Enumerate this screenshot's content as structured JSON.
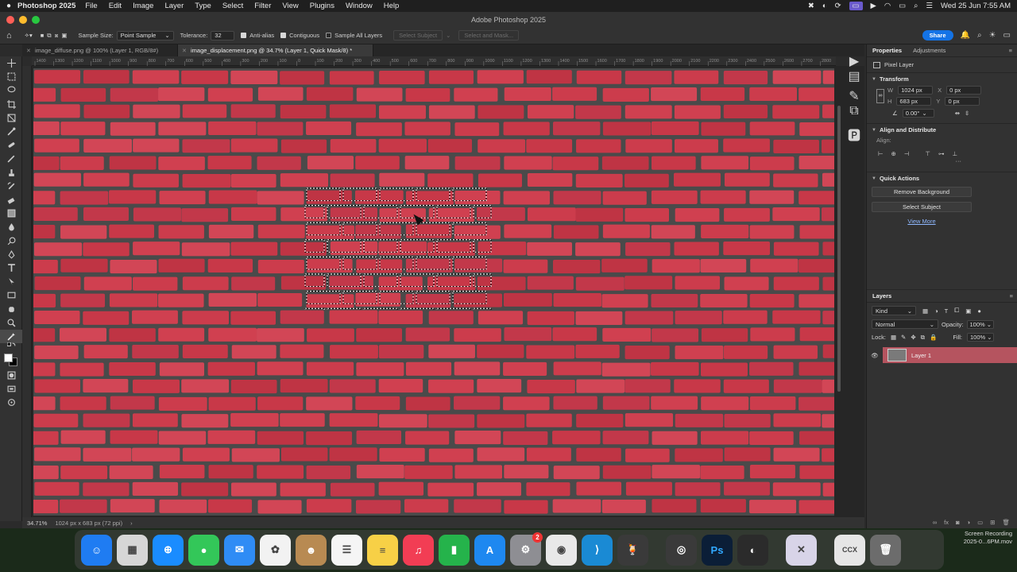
{
  "menubar": {
    "app": "Photoshop 2025",
    "menus": [
      "File",
      "Edit",
      "Image",
      "Layer",
      "Type",
      "Select",
      "Filter",
      "View",
      "Plugins",
      "Window",
      "Help"
    ],
    "center_title": "Adobe Photoshop 2025",
    "datetime": "Wed 25 Jun  7:55 AM"
  },
  "options": {
    "sample_size_label": "Sample Size:",
    "sample_size_value": "Point Sample",
    "tolerance_label": "Tolerance:",
    "tolerance_value": "32",
    "anti_alias": "Anti-alias",
    "contiguous": "Contiguous",
    "sample_all": "Sample All Layers",
    "select_subject": "Select Subject",
    "select_mask": "Select and Mask...",
    "share": "Share"
  },
  "tabs": [
    {
      "label": "image_diffuse.png @ 100% (Layer 1, RGB/8#)",
      "active": false
    },
    {
      "label": "image_displacement.png @ 34.7% (Layer 1, Quick Mask/8) *",
      "active": true
    }
  ],
  "ruler_ticks": [
    "1400",
    "1300",
    "1200",
    "1100",
    "1000",
    "900",
    "800",
    "700",
    "600",
    "500",
    "400",
    "300",
    "200",
    "100",
    "0",
    "100",
    "200",
    "300",
    "400",
    "500",
    "600",
    "700",
    "800",
    "900",
    "1000",
    "1100",
    "1200",
    "1300",
    "1400",
    "1500",
    "1600",
    "1700",
    "1800",
    "1900",
    "2000",
    "2100",
    "2200",
    "2300",
    "2400",
    "2500",
    "2600",
    "2700",
    "2800"
  ],
  "status": {
    "zoom": "34.71%",
    "doc_info": "1024 px x 683 px (72 ppi)"
  },
  "properties": {
    "tab_properties": "Properties",
    "tab_adjustments": "Adjustments",
    "pixel_layer": "Pixel Layer",
    "transform": "Transform",
    "w_label": "W",
    "w_value": "1024 px",
    "h_label": "H",
    "h_value": "683 px",
    "x_label": "X",
    "x_value": "0 px",
    "y_label": "Y",
    "y_value": "0 px",
    "angle_value": "0.00°",
    "align_distribute": "Align and Distribute",
    "align_label": "Align:",
    "quick_actions": "Quick Actions",
    "remove_bg": "Remove Background",
    "select_subject": "Select Subject",
    "view_more": "View More"
  },
  "layers": {
    "title": "Layers",
    "kind": "Kind",
    "blend": "Normal",
    "opacity_label": "Opacity:",
    "opacity_value": "100%",
    "lock_label": "Lock:",
    "fill_label": "Fill:",
    "fill_value": "100%",
    "items": [
      {
        "name": "Layer 1"
      }
    ]
  },
  "dock": {
    "apps": [
      {
        "name": "finder-icon",
        "color": "#1f7cf2",
        "glyph": "☺"
      },
      {
        "name": "launchpad-icon",
        "color": "#d6d6d6",
        "glyph": "▦"
      },
      {
        "name": "safari-icon",
        "color": "#1a8cff",
        "glyph": "⊕"
      },
      {
        "name": "messages-icon",
        "color": "#33c759",
        "glyph": "●"
      },
      {
        "name": "mail-icon",
        "color": "#2f8cf5",
        "glyph": "✉"
      },
      {
        "name": "photos-icon",
        "color": "#f2f2f2",
        "glyph": "✿"
      },
      {
        "name": "contacts-icon",
        "color": "#b88a52",
        "glyph": "☻"
      },
      {
        "name": "reminders-icon",
        "color": "#f5f5f5",
        "glyph": "☰"
      },
      {
        "name": "notes-icon",
        "color": "#f7d046",
        "glyph": "≡"
      },
      {
        "name": "music-icon",
        "color": "#f23d54",
        "glyph": "♫"
      },
      {
        "name": "numbers-icon",
        "color": "#25b34b",
        "glyph": "▮"
      },
      {
        "name": "app-store-icon",
        "color": "#1e88f0",
        "glyph": "A"
      },
      {
        "name": "system-settings-icon",
        "color": "#8e8e93",
        "glyph": "⚙",
        "badge": "2"
      },
      {
        "name": "chrome-icon",
        "color": "#e8e8e8",
        "glyph": "◉"
      },
      {
        "name": "vscode-icon",
        "color": "#1a8ad4",
        "glyph": "⟩"
      },
      {
        "name": "cocktail-icon",
        "color": "#3a3a3a",
        "glyph": "🍹"
      },
      {
        "name": "blender-icon",
        "color": "#3a3a3a",
        "glyph": "◎"
      },
      {
        "name": "photoshop-icon",
        "color": "#0b1e37",
        "glyph": "Ps"
      },
      {
        "name": "obs-icon",
        "color": "#2b2b2b",
        "glyph": "◐"
      },
      {
        "name": "preview-icon",
        "color": "#d8d4e8",
        "glyph": "✕"
      },
      {
        "name": "ccx-icon",
        "color": "#e6e6e6",
        "glyph": "CCX"
      },
      {
        "name": "trash-icon",
        "color": "#6c6c6c",
        "glyph": "🗑"
      }
    ],
    "recording_title": "Screen Recording",
    "recording_file": "2025-0...6PM.mov"
  },
  "colors": {
    "brick": "#cc3c4c",
    "mortar": "#4a4a4a",
    "accent": "#1473e6",
    "layer_selected": "#b5545f"
  }
}
